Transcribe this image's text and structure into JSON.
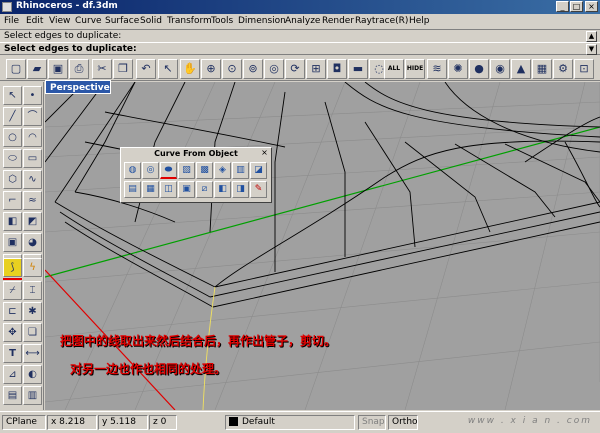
{
  "window": {
    "title": "Rhinoceros - df.3dm"
  },
  "menu": [
    "File",
    "Edit",
    "View",
    "Curve",
    "Surface",
    "Solid",
    "Transform",
    "Tools",
    "Dimension",
    "Analyze",
    "Render",
    "Raytrace(R)",
    "Help"
  ],
  "command": {
    "history": "Select edges to duplicate:",
    "prompt": "Select edges to duplicate:"
  },
  "toolbar": {
    "all_label": "ALL",
    "hide_label": "HIDE"
  },
  "viewport": {
    "name": "Perspective"
  },
  "curve_from_object": {
    "title": "Curve From Object"
  },
  "annotations": [
    "把图中的线取出来然后结合后，再作出管子，剪切。",
    "对另一边也作也相同的处理。"
  ],
  "status": {
    "cplane": "CPlane",
    "x": "x 8.218",
    "y": "y 5.118",
    "z": "z 0",
    "layer": "Default",
    "snap": "Snap",
    "ortho": "Ortho"
  },
  "watermark": "www . x i a n . com",
  "colors": {
    "viewport_bg": "#a0a0a0",
    "grid_x_axis": "#e00000",
    "grid_y_axis": "#00a000",
    "annotation_text": "#e00000",
    "viewport_tab": "#2b57a8"
  }
}
